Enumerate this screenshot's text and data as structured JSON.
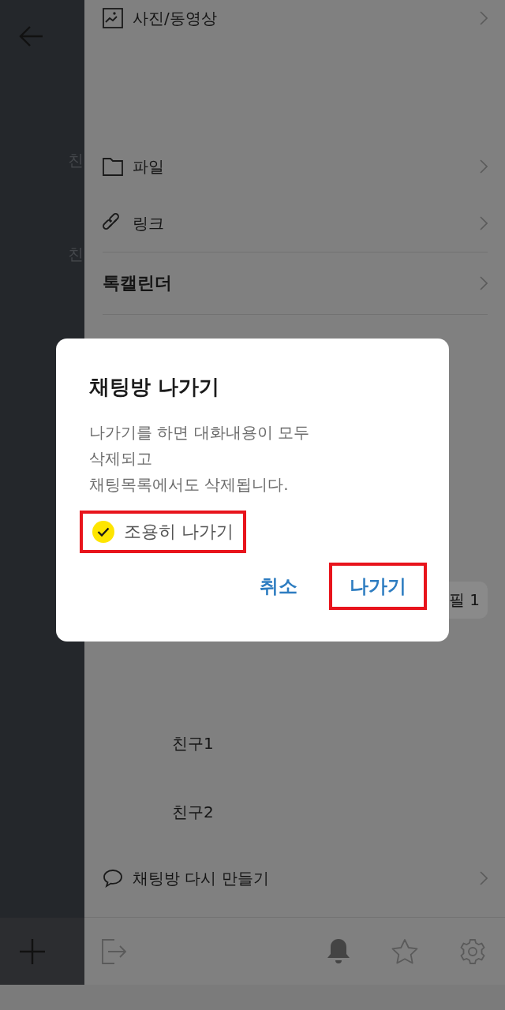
{
  "chat": {
    "partial_names": [
      "친",
      "친"
    ]
  },
  "drawer": {
    "menu": [
      {
        "kind": "photo",
        "label": "사진/동영상"
      },
      {
        "kind": "file",
        "label": "파일"
      },
      {
        "kind": "link",
        "label": "링크"
      },
      {
        "kind": "section",
        "label": "톡캘린더"
      }
    ],
    "chip": "필 1",
    "members": [
      {
        "name": "친구1"
      },
      {
        "name": "친구2"
      }
    ],
    "recreate": "채팅방 다시 만들기"
  },
  "dialog": {
    "title": "채팅방 나가기",
    "message": "나가기를 하면 대화내용이 모두\n삭제되고\n채팅목록에서도 삭제됩니다.",
    "option": {
      "label": "조용히 나가기",
      "checked": true,
      "highlighted": true
    },
    "buttons": [
      {
        "label": "취소",
        "highlighted": false
      },
      {
        "label": "나가기",
        "highlighted": true
      }
    ]
  }
}
